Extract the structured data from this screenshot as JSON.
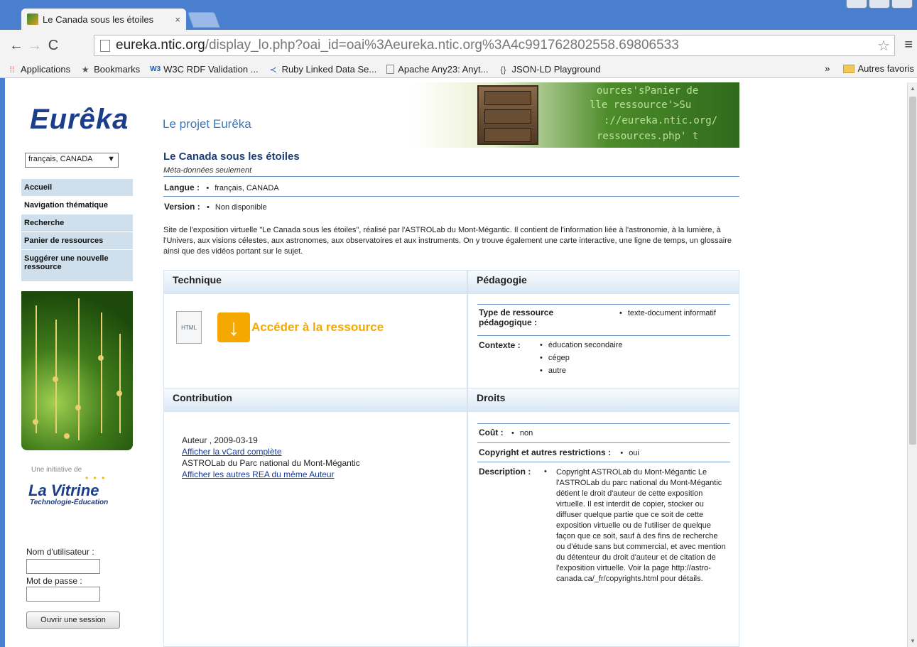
{
  "browser": {
    "tab_title": "Le Canada sous les étoiles",
    "tab_close": "×",
    "url_host": "eureka.ntic.org",
    "url_rest": "/display_lo.php?oai_id=oai%3Aeureka.ntic.org%3A4c991762802558.69806533",
    "bookmarks": [
      "Applications",
      "Bookmarks",
      "W3C RDF Validation ...",
      "Ruby Linked Data Se...",
      "Apache Any23: Anyt...",
      "JSON-LD Playground"
    ],
    "bookmarks_overflow": "»",
    "other_bookmarks": "Autres favoris"
  },
  "site": {
    "logo": "Eurêka",
    "project": "Le projet Eurêka",
    "banner_lines": [
      "ources'sPanier de",
      "lle ressource'>Su",
      "://eureka.ntic.org/",
      "ressources.php' t"
    ]
  },
  "sidebar": {
    "language": "français, CANADA",
    "items": [
      {
        "label": "Accueil"
      },
      {
        "label": "Navigation thématique"
      },
      {
        "label": "Recherche"
      },
      {
        "label": "Panier de ressources"
      },
      {
        "label": "Suggérer une nouvelle ressource"
      }
    ],
    "initiative": "Une initiative de",
    "vitrine": "La Vitrine",
    "vitrine_sub": "Technologie-Éducation",
    "username_label": "Nom d'utilisateur :",
    "password_label": "Mot de passe :",
    "login_button": "Ouvrir une session"
  },
  "resource": {
    "title": "Le Canada sous les étoiles",
    "subtitle": "Méta-données seulement",
    "langue_label": "Langue :",
    "langue_value": "français, CANADA",
    "version_label": "Version :",
    "version_value": "Non disponible",
    "description": "Site de l'exposition virtuelle \"Le Canada sous les étoiles\", réalisé par l'ASTROLab du Mont-Mégantic. Il contient de l'information liée à l'astronomie, à la lumière, à l'Univers, aux visions célestes, aux astronomes, aux observatoires et aux instruments. On y trouve également une carte interactive, une ligne de temps, un glossaire ainsi que des vidéos portant sur le sujet."
  },
  "panels": {
    "technique": {
      "title": "Technique",
      "doc_icon_text": "HTML",
      "access_label": "Accéder à la ressource"
    },
    "pedagogie": {
      "title": "Pédagogie",
      "type_label": "Type de ressource pédagogique :",
      "type_value": "texte-document informatif",
      "contexte_label": "Contexte :",
      "contexte_values": [
        "éducation secondaire",
        "cégep",
        "autre"
      ]
    },
    "contribution": {
      "title": "Contribution",
      "author_line": "Auteur , 2009-03-19",
      "vcard_link": "Afficher la vCard complète",
      "org": "ASTROLab du Parc national du Mont-Mégantic",
      "others_link": "Afficher les autres REA du même Auteur"
    },
    "droits": {
      "title": "Droits",
      "cout_label": "Coût :",
      "cout_value": "non",
      "copyright_label": "Copyright et autres restrictions :",
      "copyright_value": "oui",
      "description_label": "Description :",
      "description_value": "Copyright ASTROLab du Mont-Mégantic Le l'ASTROLab du parc national du Mont-Mégantic détient le droit d'auteur de cette exposition virtuelle. Il est interdit de copier, stocker ou diffuser quelque partie que ce soit de cette exposition virtuelle ou de l'utiliser de quelque façon que ce soit, sauf à des fins de recherche ou d'étude sans but commercial, et avec mention du détenteur du droit d'auteur et de citation de l'exposition virtuelle. Voir la page http://astro-canada.ca/_fr/copyrights.html pour détails."
    }
  }
}
